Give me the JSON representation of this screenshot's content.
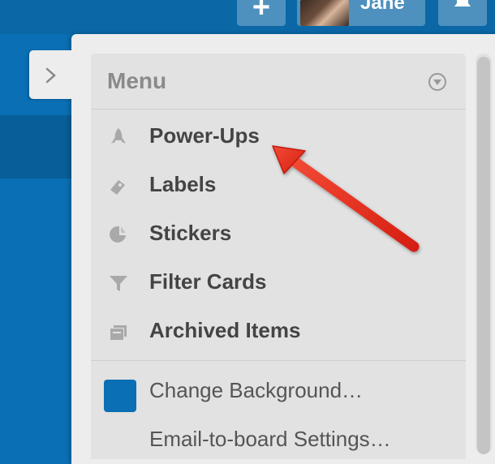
{
  "header": {
    "add_label": "+",
    "user_name": "Jane"
  },
  "menu": {
    "title": "Menu",
    "items": [
      {
        "label": "Power-Ups",
        "icon": "rocket-icon"
      },
      {
        "label": "Labels",
        "icon": "tag-icon"
      },
      {
        "label": "Stickers",
        "icon": "sticker-icon"
      },
      {
        "label": "Filter Cards",
        "icon": "filter-icon"
      },
      {
        "label": "Archived Items",
        "icon": "archive-icon"
      }
    ],
    "secondary": [
      {
        "label": "Change Background…",
        "swatch_color": "#0a6fb4"
      },
      {
        "label": "Email-to-board Settings…"
      }
    ]
  },
  "colors": {
    "board_bg": "#0a6fb4",
    "panel_bg": "#ededed",
    "menu_bg": "#e2e2e2",
    "annotation_arrow": "#e8291c"
  }
}
